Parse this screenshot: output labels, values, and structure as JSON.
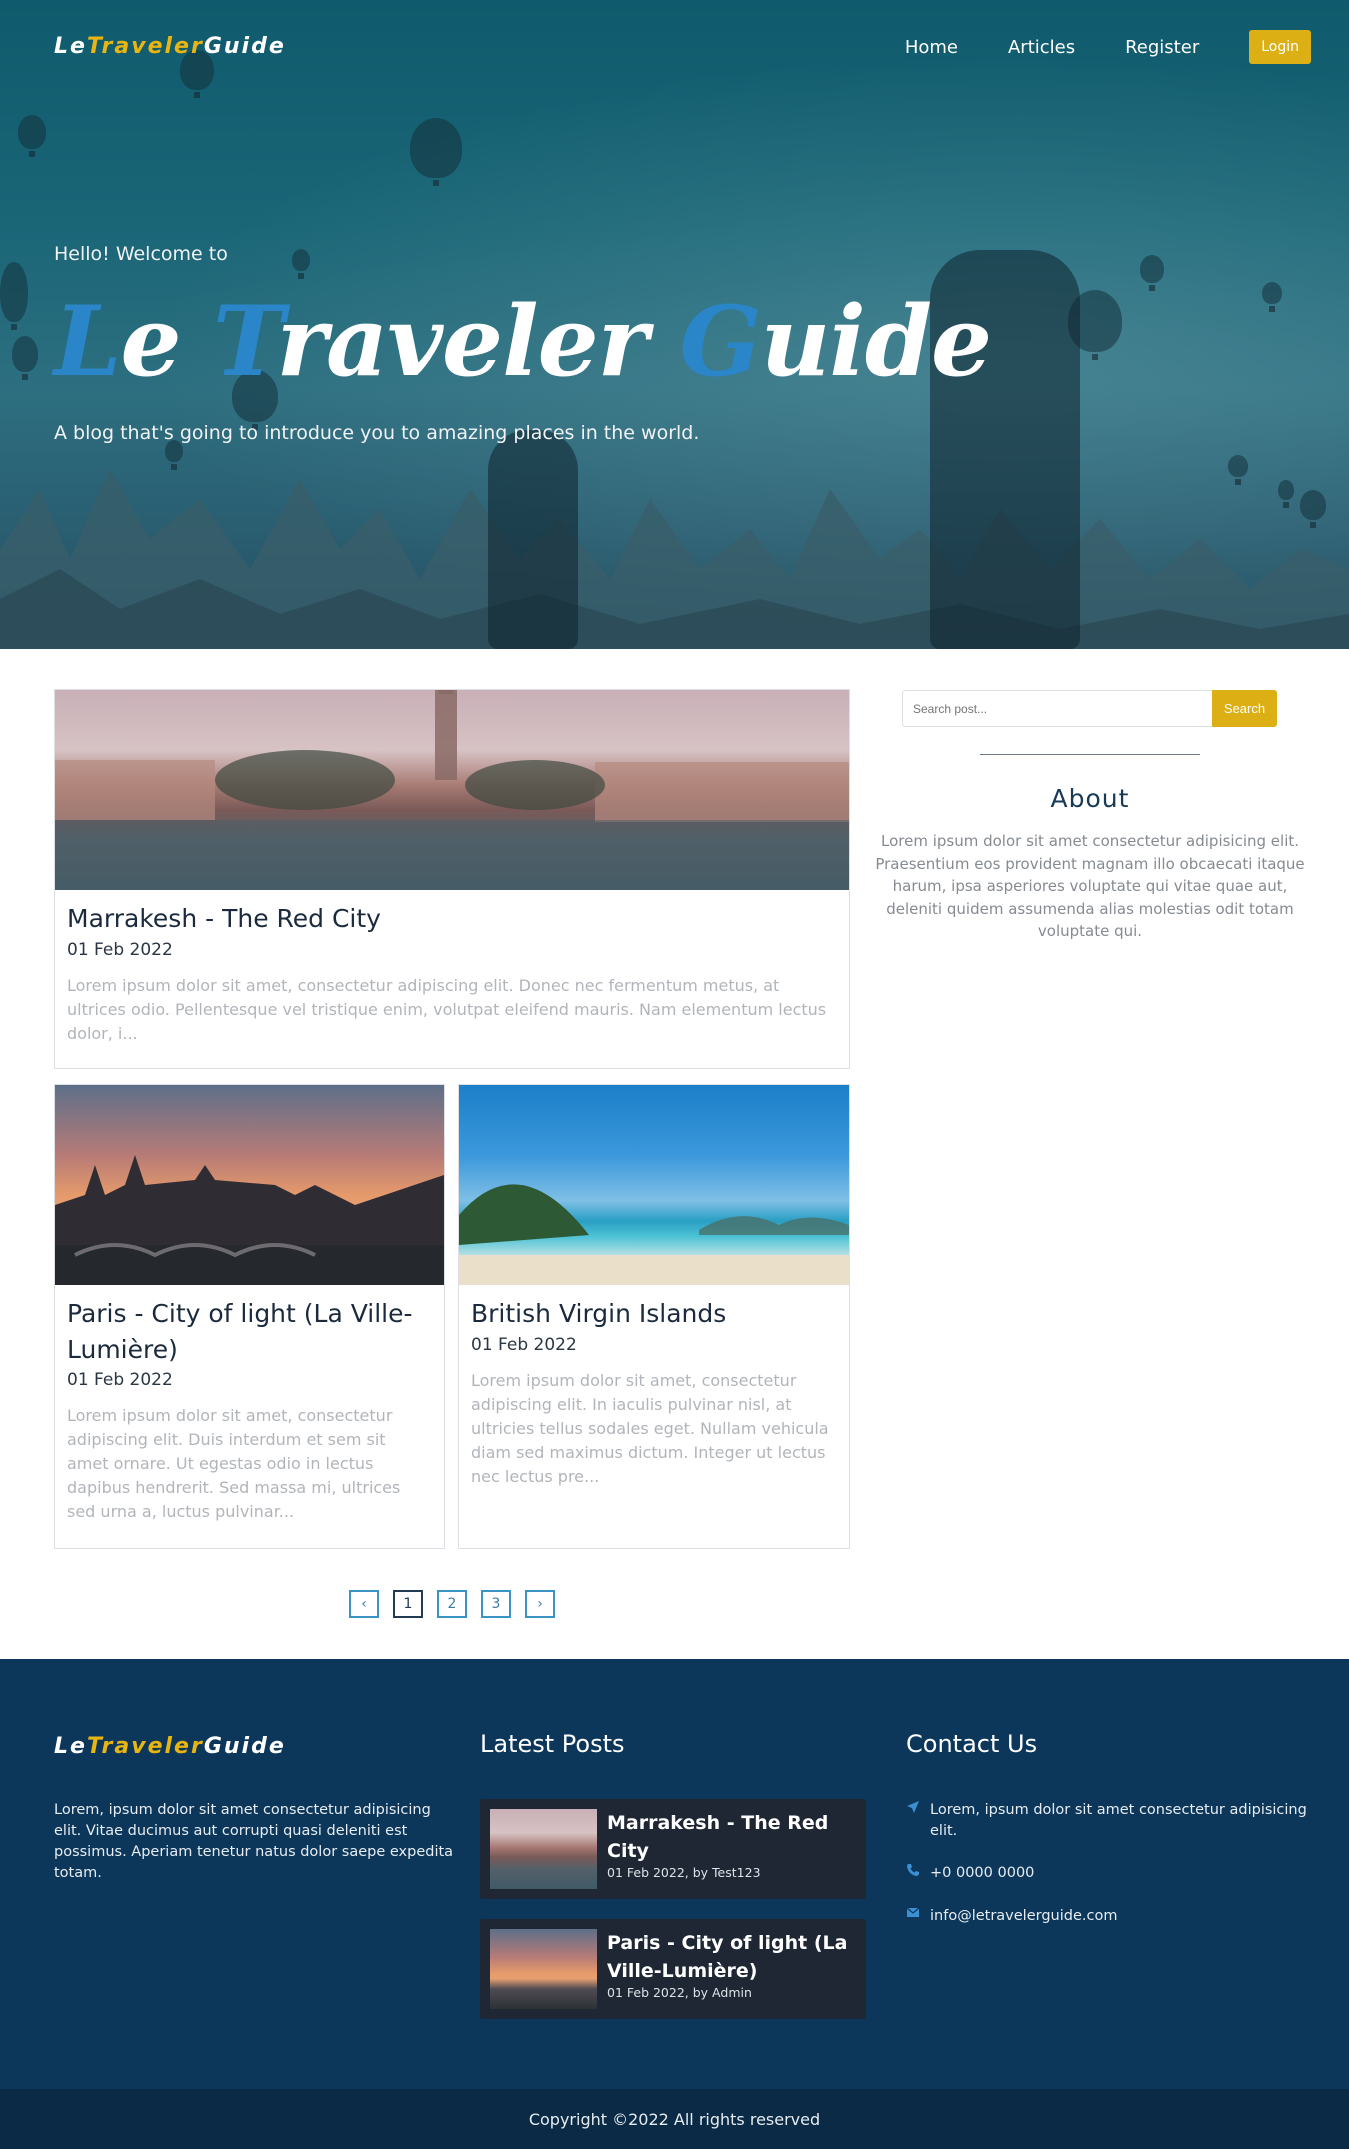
{
  "nav": {
    "logo_le": "Le",
    "logo_traveler": "Traveler",
    "logo_guide": "Guide",
    "links": [
      "Home",
      "Articles",
      "Register"
    ],
    "login_label": "Login"
  },
  "hero": {
    "hello": "Hello! Welcome to",
    "title": {
      "w1_cap": "L",
      "w1_rest": "e",
      "w2_cap": "T",
      "w2_rest": "raveler",
      "w3_cap": "G",
      "w3_rest": "uide"
    },
    "subtitle": "A blog that's going to introduce you to amazing places in the world."
  },
  "posts": [
    {
      "title": "Marrakesh - The Red City",
      "date": "01 Feb 2022",
      "excerpt": "Lorem ipsum dolor sit amet, consectetur adipiscing elit. Donec nec fermentum metus, at ultrices odio. Pellentesque vel tristique enim, volutpat eleifend mauris. Nam elementum lectus dolor, i..."
    },
    {
      "title": "Paris - City of light (La Ville-Lumière)",
      "date": "01 Feb 2022",
      "excerpt": "Lorem ipsum dolor sit amet, consectetur adipiscing elit. Duis interdum et sem sit amet ornare. Ut egestas odio in lectus dapibus hendrerit. Sed massa mi, ultrices sed urna a, luctus pulvinar..."
    },
    {
      "title": "British Virgin Islands",
      "date": "01 Feb 2022",
      "excerpt": "Lorem ipsum dolor sit amet, consectetur adipiscing elit. In iaculis pulvinar nisl, at ultricies tellus sodales eget. Nullam vehicula diam sed maximus dictum. Integer ut lectus nec lectus pre..."
    }
  ],
  "pagination": {
    "prev": "‹",
    "pages": [
      "1",
      "2",
      "3"
    ],
    "next": "›",
    "current": "1"
  },
  "sidebar": {
    "search_placeholder": "Search post...",
    "search_button": "Search",
    "about_title": "About",
    "about_text": "Lorem ipsum dolor sit amet consectetur adipisicing elit. Praesentium eos provident magnam illo obcaecati itaque harum, ipsa asperiores voluptate qui vitae quae aut, deleniti quidem assumenda alias molestias odit totam voluptate qui."
  },
  "footer": {
    "logo_le": "Le",
    "logo_traveler": "Traveler",
    "logo_guide": "Guide",
    "about": "Lorem, ipsum dolor sit amet consectetur adipisicing elit. Vitae ducimus aut corrupti quasi deleniti est possimus. Aperiam tenetur natus dolor saepe expedita totam.",
    "latest_title": "Latest Posts",
    "latest": [
      {
        "title": "Marrakesh - The Red City",
        "meta": "01 Feb 2022, by Test123"
      },
      {
        "title": "Paris - City of light (La Ville-Lumière)",
        "meta": "01 Feb 2022, by Admin"
      }
    ],
    "contact_title": "Contact Us",
    "contact": {
      "address": "Lorem, ipsum dolor sit amet consectetur adipisicing elit.",
      "phone": "+0 0000 0000",
      "email": "info@letravelerguide.com",
      "icons": [
        "location-arrow-icon",
        "phone-icon",
        "envelope-icon"
      ]
    },
    "copyright": "Copyright ©2022 All rights reserved"
  },
  "colors": {
    "accent_yellow": "#dcb014",
    "accent_blue": "#2a86c9",
    "footer_bg": "#0c375a",
    "copyright_bg": "#0a2a45"
  }
}
